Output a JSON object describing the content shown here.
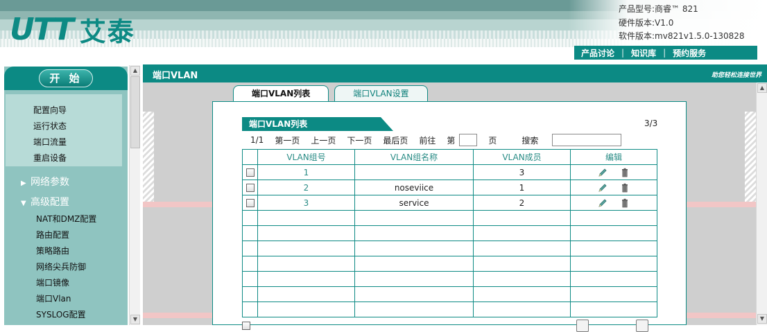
{
  "brand": {
    "mark": "UTT",
    "name": "艾泰"
  },
  "product": {
    "model": "产品型号:商睿™ 821",
    "hardware": "硬件版本:V1.0",
    "software": "软件版本:mv821v1.5.0-130828"
  },
  "top_nav": [
    {
      "label": "产品讨论"
    },
    {
      "label": "知识库"
    },
    {
      "label": "预约服务"
    }
  ],
  "sidebar": {
    "start_label": "开 始",
    "quick": [
      {
        "label": "配置向导"
      },
      {
        "label": "运行状态"
      },
      {
        "label": "端口流量"
      },
      {
        "label": "重启设备"
      }
    ],
    "groups": [
      {
        "label": "网络参数",
        "arrow": "▶"
      },
      {
        "label": "高级配置",
        "arrow": "▼"
      }
    ],
    "advanced_items": [
      {
        "label": "NAT和DMZ配置"
      },
      {
        "label": "路由配置"
      },
      {
        "label": "策略路由"
      },
      {
        "label": "网络尖兵防御"
      },
      {
        "label": "端口镜像"
      },
      {
        "label": "端口Vlan"
      },
      {
        "label": "SYSLOG配置"
      }
    ]
  },
  "main": {
    "title": "端口VLAN",
    "slogan": "助您轻松连接世界",
    "tabs": [
      {
        "label": "端口VLAN列表",
        "active": true
      },
      {
        "label": "端口VLAN设置",
        "active": false
      }
    ],
    "list": {
      "title": "端口VLAN列表",
      "count": "3/3",
      "pager": {
        "page": "1/1",
        "first": "第一页",
        "prev": "上一页",
        "next": "下一页",
        "last": "最后页",
        "goto": "前往",
        "di": "第",
        "ye": "页",
        "search": "搜索",
        "page_value": "",
        "search_value": ""
      },
      "columns": [
        "VLAN组号",
        "VLAN组名称",
        "VLAN成员",
        "编辑"
      ],
      "rows": [
        {
          "id": "1",
          "name": "",
          "members": "3"
        },
        {
          "id": "2",
          "name": "noseviice",
          "members": "1"
        },
        {
          "id": "3",
          "name": "service",
          "members": "2"
        }
      ],
      "empty_rows": 7
    }
  }
}
